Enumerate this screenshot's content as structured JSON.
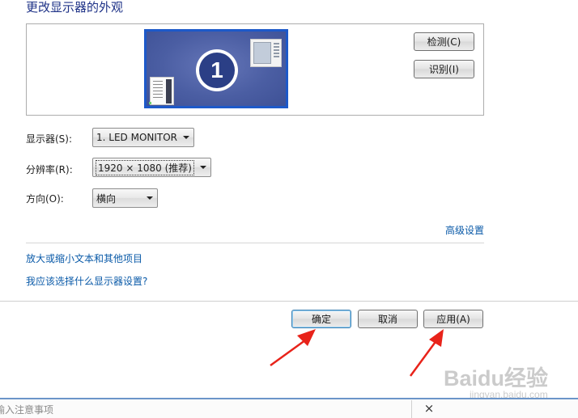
{
  "page": {
    "title": "更改显示器的外观"
  },
  "preview": {
    "monitor_number": "1"
  },
  "buttons": {
    "detect": "检测(C)",
    "identify": "识别(I)"
  },
  "settings": {
    "display_label": "显示器(S):",
    "display_value": "1. LED MONITOR",
    "resolution_label": "分辨率(R):",
    "resolution_value": "1920 × 1080 (推荐)",
    "orientation_label": "方向(O):",
    "orientation_value": "横向"
  },
  "links": {
    "advanced": "高级设置",
    "text_size": "放大或缩小文本和其他项目",
    "which_settings": "我应该选择什么显示器设置?"
  },
  "footer": {
    "ok": "确定",
    "cancel": "取消",
    "apply": "应用(A)"
  },
  "taskbar": {
    "input_text": "输入注意事项",
    "close": "×"
  },
  "annotation": {
    "arrow_color": "#e8231a"
  },
  "watermark": {
    "main": "Baidu经验",
    "sub": "jingyan.baidu.com"
  }
}
